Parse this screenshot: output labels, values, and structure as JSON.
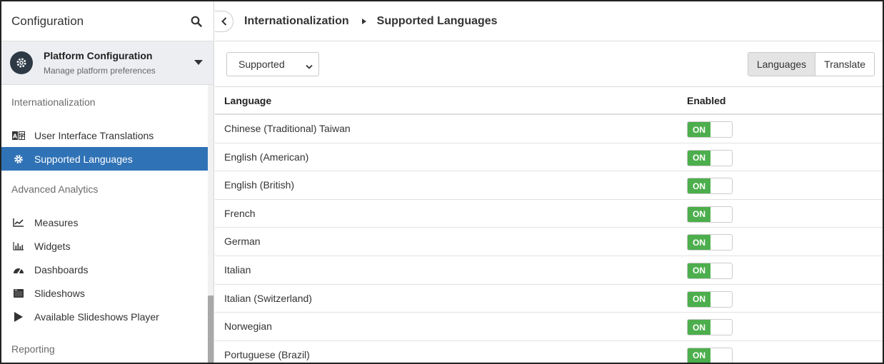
{
  "sidebar": {
    "title": "Configuration",
    "platform": {
      "name": "Platform Configuration",
      "subtitle": "Manage platform preferences"
    },
    "sections": [
      {
        "label": "Internationalization",
        "items": [
          {
            "label": "User Interface Translations",
            "icon": "translate-icon"
          },
          {
            "label": "Supported Languages",
            "icon": "gear-icon",
            "active": true
          }
        ]
      },
      {
        "label": "Advanced Analytics",
        "items": [
          {
            "label": "Measures",
            "icon": "line-chart-icon"
          },
          {
            "label": "Widgets",
            "icon": "bar-chart-icon"
          },
          {
            "label": "Dashboards",
            "icon": "gauge-icon"
          },
          {
            "label": "Slideshows",
            "icon": "slideshow-icon"
          },
          {
            "label": "Available Slideshows Player",
            "icon": "play-icon"
          }
        ]
      },
      {
        "label": "Reporting",
        "items": []
      }
    ]
  },
  "breadcrumb": {
    "parent": "Internationalization",
    "current": "Supported Languages"
  },
  "toolbar": {
    "filter_value": "Supported",
    "view_languages": "Languages",
    "view_translate": "Translate"
  },
  "table": {
    "headers": {
      "language": "Language",
      "enabled": "Enabled"
    },
    "rows": [
      {
        "language": "Chinese (Traditional) Taiwan",
        "enabled": "ON"
      },
      {
        "language": "English (American)",
        "enabled": "ON"
      },
      {
        "language": "English (British)",
        "enabled": "ON"
      },
      {
        "language": "French",
        "enabled": "ON"
      },
      {
        "language": "German",
        "enabled": "ON"
      },
      {
        "language": "Italian",
        "enabled": "ON"
      },
      {
        "language": "Italian (Switzerland)",
        "enabled": "ON"
      },
      {
        "language": "Norwegian",
        "enabled": "ON"
      },
      {
        "language": "Portuguese (Brazil)",
        "enabled": "ON"
      }
    ]
  },
  "colors": {
    "active_nav": "#2f72b6",
    "toggle_on": "#4cae4c"
  }
}
